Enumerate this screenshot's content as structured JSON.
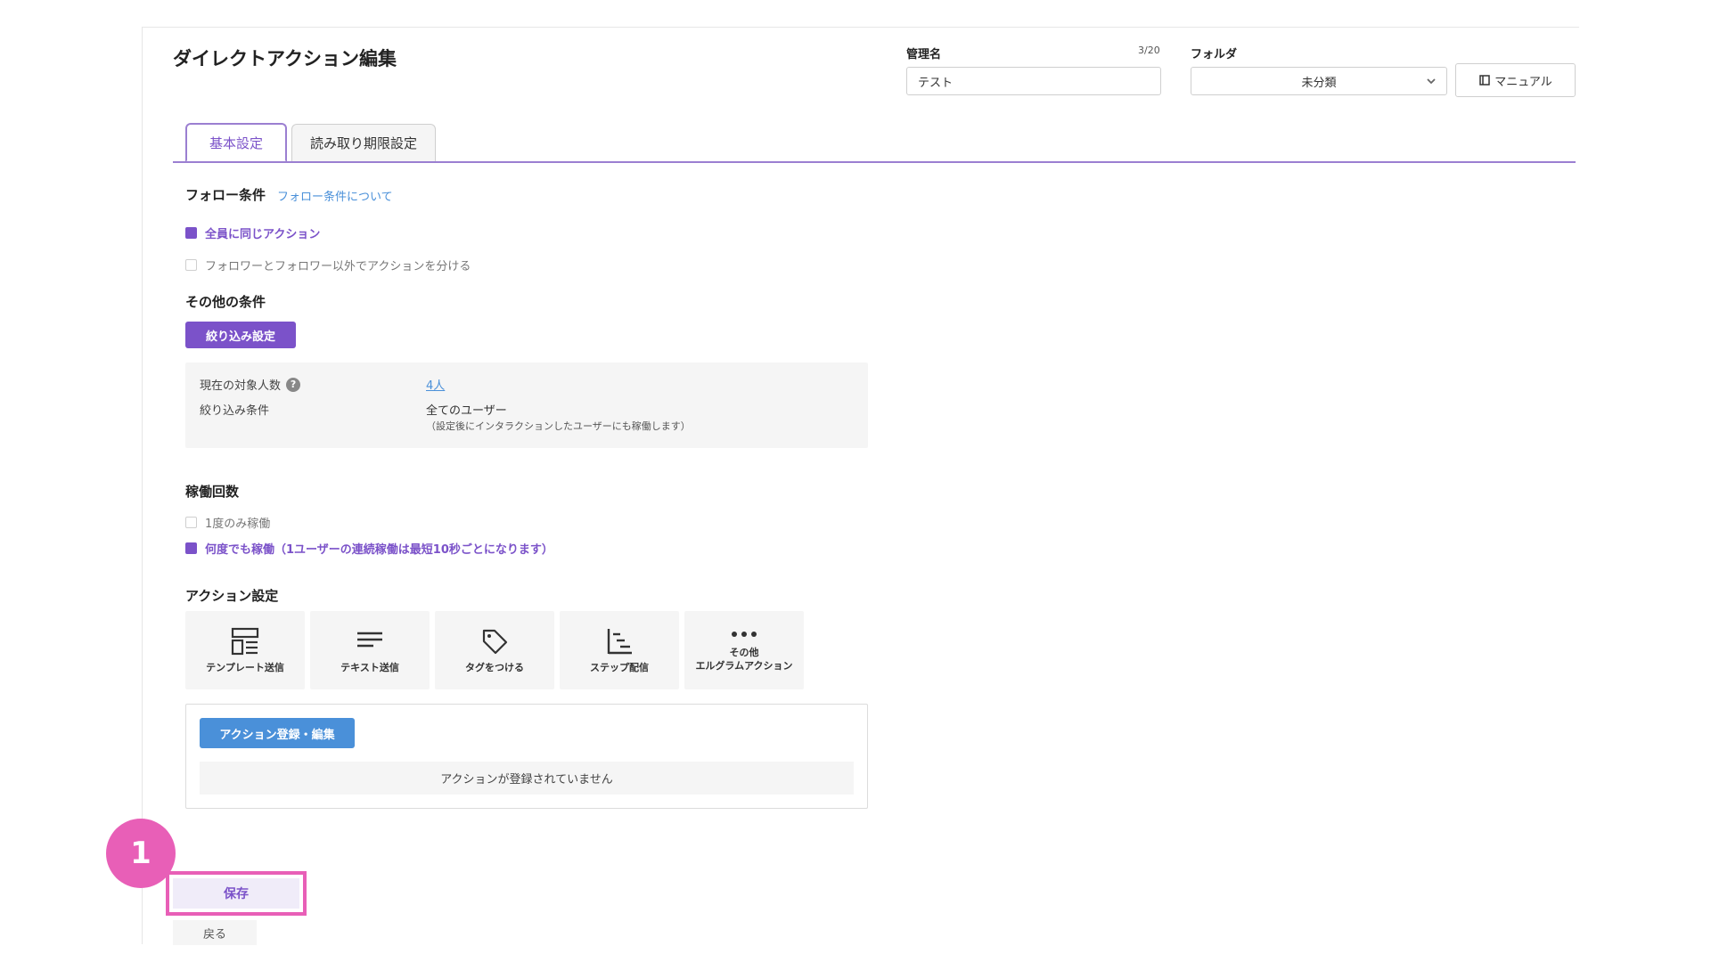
{
  "header": {
    "title": "ダイレクトアクション編集",
    "name_label": "管理名",
    "name_counter": "3/20",
    "name_value": "テスト",
    "folder_label": "フォルダ",
    "folder_value": "未分類",
    "manual_label": "マニュアル"
  },
  "tabs": [
    {
      "label": "基本設定",
      "active": true
    },
    {
      "label": "読み取り期限設定",
      "active": false
    }
  ],
  "follow": {
    "title": "フォロー条件",
    "help_link": "フォロー条件について",
    "options": [
      {
        "label": "全員に同じアクション",
        "checked": true
      },
      {
        "label": "フォロワーとフォロワー以外でアクションを分ける",
        "checked": false
      }
    ]
  },
  "other": {
    "title": "その他の条件",
    "filter_button": "絞り込み設定",
    "target_label": "現在の対象人数",
    "target_value": "4人",
    "filter_label": "絞り込み条件",
    "filter_value": "全てのユーザー",
    "filter_note": "（設定後にインタラクションしたユーザーにも稼働します）"
  },
  "runs": {
    "title": "稼働回数",
    "options": [
      {
        "label": "1度のみ稼働",
        "checked": false
      },
      {
        "label": "何度でも稼働（1ユーザーの連続稼働は最短10秒ごとになります）",
        "checked": true
      }
    ]
  },
  "actions": {
    "title": "アクション設定",
    "tiles": [
      {
        "label": "テンプレート送信",
        "icon": "template-icon"
      },
      {
        "label": "テキスト送信",
        "icon": "text-lines-icon"
      },
      {
        "label": "タグをつける",
        "icon": "tag-icon"
      },
      {
        "label": "ステップ配信",
        "icon": "step-icon"
      },
      {
        "label": "その他\nエルグラムアクション",
        "label_line1": "その他",
        "label_line2": "エルグラムアクション",
        "icon": "more-dots-icon"
      }
    ],
    "register_button": "アクション登録・編集",
    "empty_message": "アクションが登録されていません"
  },
  "footer": {
    "step_badge": "1",
    "save_label": "保存",
    "back_label": "戻る"
  },
  "colors": {
    "accent": "#7b52c9",
    "link": "#4a90d9",
    "highlight": "#e85fb7"
  }
}
